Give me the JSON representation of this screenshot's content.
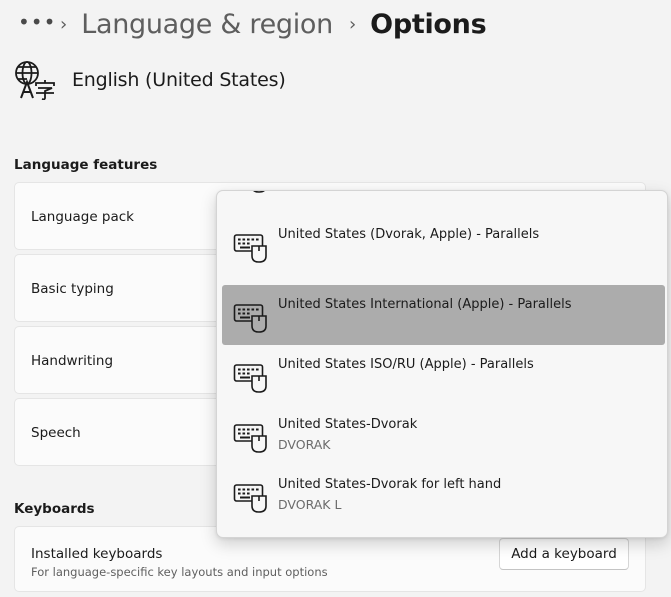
{
  "breadcrumb": {
    "more": "•••",
    "separator": "›",
    "parent": "Language & region",
    "current": "Options"
  },
  "language": {
    "name": "English (United States)",
    "icon": "language-icon"
  },
  "language_features": {
    "title": "Language features",
    "items": [
      "Language pack",
      "Basic typing",
      "Handwriting",
      "Speech"
    ]
  },
  "keyboards": {
    "title": "Keyboards",
    "installed_label": "Installed keyboards",
    "installed_sub": "For language-specific key layouts and input options",
    "add_button": "Add a keyboard"
  },
  "dropdown": {
    "icon": "keyboard-mouse-icon",
    "options": [
      {
        "label": "United States (Dvorak, Apple) - Parallels",
        "sub": "",
        "selected": false
      },
      {
        "label": "United States International (Apple) - Parallels",
        "sub": "",
        "selected": true
      },
      {
        "label": "United States ISO/RU (Apple) - Parallels",
        "sub": "",
        "selected": false
      },
      {
        "label": "United States-Dvorak",
        "sub": "DVORAK",
        "selected": false
      },
      {
        "label": "United States-Dvorak for left hand",
        "sub": "DVORAK L",
        "selected": false
      }
    ]
  },
  "colors": {
    "selected_bg": "#acacac",
    "page_bg": "#f3f3f3",
    "card_bg": "#fbfbfb"
  }
}
